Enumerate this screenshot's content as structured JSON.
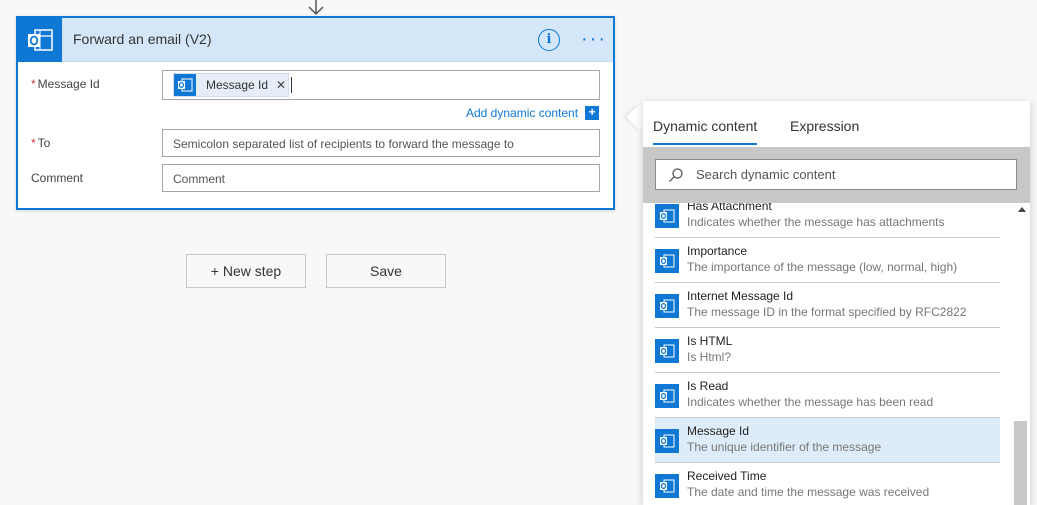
{
  "card": {
    "title": "Forward an email (V2)",
    "icons": {
      "app": "outlook-icon",
      "info": "info-icon",
      "more": "more-options-icon"
    },
    "fields": {
      "message_id": {
        "label": "Message Id",
        "required": "*",
        "token": "Message Id"
      },
      "to": {
        "label": "To",
        "required": "*",
        "placeholder": "Semicolon separated list of recipients to forward the message to"
      },
      "comment": {
        "label": "Comment",
        "placeholder": "Comment"
      }
    },
    "add_dynamic_label": "Add dynamic content",
    "add_dynamic_plus": "+"
  },
  "buttons": {
    "new_step": "+ New step",
    "save": "Save"
  },
  "panel": {
    "tabs": [
      "Dynamic content",
      "Expression"
    ],
    "active_tab": "Dynamic content",
    "search_placeholder": "Search dynamic content",
    "items": [
      {
        "name": "Has Attachment",
        "desc": "Indicates whether the message has attachments"
      },
      {
        "name": "Importance",
        "desc": "The importance of the message (low, normal, high)"
      },
      {
        "name": "Internet Message Id",
        "desc": "The message ID in the format specified by RFC2822"
      },
      {
        "name": "Is HTML",
        "desc": "Is Html?"
      },
      {
        "name": "Is Read",
        "desc": "Indicates whether the message has been read"
      },
      {
        "name": "Message Id",
        "desc": "The unique identifier of the message",
        "selected": true
      },
      {
        "name": "Received Time",
        "desc": "The date and time the message was received"
      }
    ]
  },
  "colors": {
    "accent": "#0f78d4",
    "header_bg": "#d3e7f9",
    "required": "#d13438",
    "selected_row": "#deecf9"
  }
}
